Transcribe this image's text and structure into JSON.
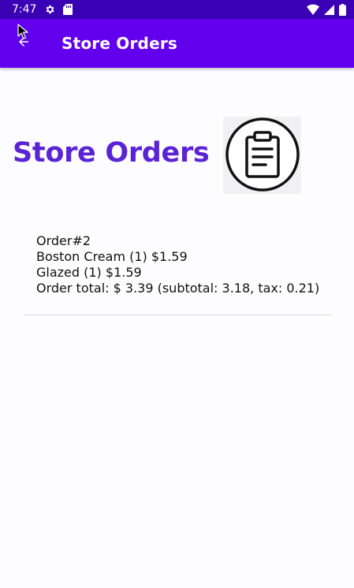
{
  "status_bar": {
    "time": "7:47",
    "icons": [
      "settings-icon",
      "sd-card-icon",
      "wifi-icon",
      "signal-icon",
      "battery-icon"
    ]
  },
  "app_bar": {
    "title": "Store Orders",
    "back_icon": "arrow-back-icon"
  },
  "header": {
    "heading": "Store Orders",
    "logo_icon": "clipboard-icon"
  },
  "orders": [
    {
      "number": "Order#2",
      "items": [
        "Boston Cream (1)  $1.59",
        "Glazed (1)  $1.59"
      ],
      "total": "Order total: $ 3.39 (subtotal: 3.18, tax: 0.21)"
    }
  ],
  "colors": {
    "status_bar": "#3a00b4",
    "app_bar": "#6200ee",
    "heading": "#5a23d6",
    "background": "#fdfcff"
  }
}
